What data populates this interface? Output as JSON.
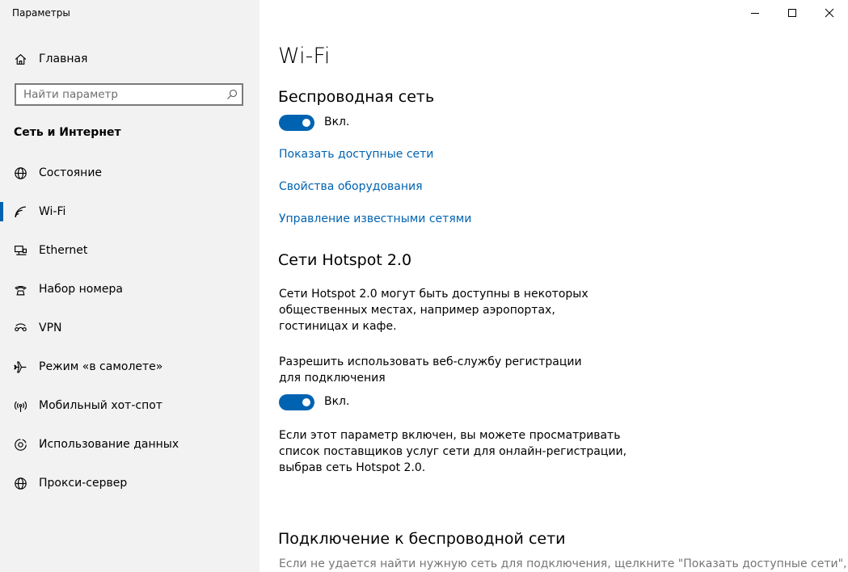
{
  "window": {
    "title": "Параметры",
    "controls": [
      "minimize-icon",
      "maximize-icon",
      "close-icon"
    ]
  },
  "sidebar": {
    "home": {
      "label": "Главная",
      "icon": "home-icon"
    },
    "search": {
      "placeholder": "Найти параметр",
      "value": "",
      "icon": "search-icon"
    },
    "section_title": "Сеть и Интернет",
    "items": [
      {
        "label": "Состояние",
        "icon": "globe-icon"
      },
      {
        "label": "Wi-Fi",
        "icon": "wifi-icon",
        "selected": true
      },
      {
        "label": "Ethernet",
        "icon": "ethernet-icon"
      },
      {
        "label": "Набор номера",
        "icon": "dialup-icon"
      },
      {
        "label": "VPN",
        "icon": "vpn-icon"
      },
      {
        "label": "Режим «в самолете»",
        "icon": "airplane-icon"
      },
      {
        "label": "Мобильный хот-спот",
        "icon": "hotspot-icon"
      },
      {
        "label": "Использование данных",
        "icon": "data-usage-icon"
      },
      {
        "label": "Прокси-сервер",
        "icon": "proxy-icon"
      }
    ]
  },
  "main": {
    "title": "Wi-Fi",
    "wireless": {
      "heading": "Беспроводная сеть",
      "toggle_label": "Вкл.",
      "toggle_on": true
    },
    "links": [
      "Показать доступные сети",
      "Свойства оборудования",
      "Управление известными сетями"
    ],
    "hotspot": {
      "heading": "Сети Hotspot 2.0",
      "description": "Сети Hotspot 2.0 могут быть доступны в некоторых общественных местах, например аэропортах, гостиницах и кафе.",
      "setting_label": "Разрешить использовать веб-службу регистрации для подключения",
      "toggle_label": "Вкл.",
      "toggle_on": true,
      "note": "Если этот параметр включен, вы можете просматривать список поставщиков услуг сети для онлайн-регистрации, выбрав сеть Hotspot 2.0."
    },
    "connect": {
      "heading": "Подключение к беспроводной сети",
      "description": "Если не удается найти нужную сеть для подключения, щелкните \"Показать доступные сети\","
    }
  },
  "colors": {
    "accent": "#0063b1",
    "sidebar_bg": "#f2f2f2",
    "secondary_text": "#767676"
  }
}
